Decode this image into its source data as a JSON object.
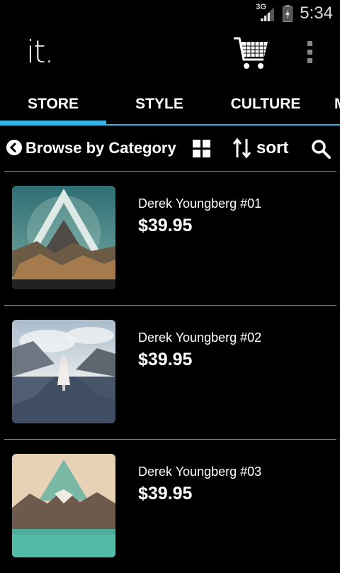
{
  "status_bar": {
    "network_type": "3G",
    "time": "5:34",
    "icons": [
      "signal-icon",
      "battery-icon"
    ]
  },
  "app_bar": {
    "logo": "it.",
    "icons": [
      "cart-icon",
      "overflow-menu-icon"
    ]
  },
  "tabs": [
    {
      "label": "STORE",
      "selected": true
    },
    {
      "label": "STYLE",
      "selected": false
    },
    {
      "label": "CULTURE",
      "selected": false
    },
    {
      "label": "M",
      "selected": false
    }
  ],
  "toolbar": {
    "category_label": "Browse by Category",
    "sort_label": "sort",
    "icons": [
      "chevron-left-circle-icon",
      "grid-icon",
      "sort-arrows-icon",
      "search-icon"
    ]
  },
  "products": [
    {
      "title": "Derek Youngberg #01",
      "price": "$39.95"
    },
    {
      "title": "Derek Youngberg #02",
      "price": "$39.95"
    },
    {
      "title": "Derek Youngberg #03",
      "price": "$39.95"
    }
  ],
  "colors": {
    "accent": "#33b5e5",
    "background": "#000000",
    "divider": "#8a8a8a"
  }
}
